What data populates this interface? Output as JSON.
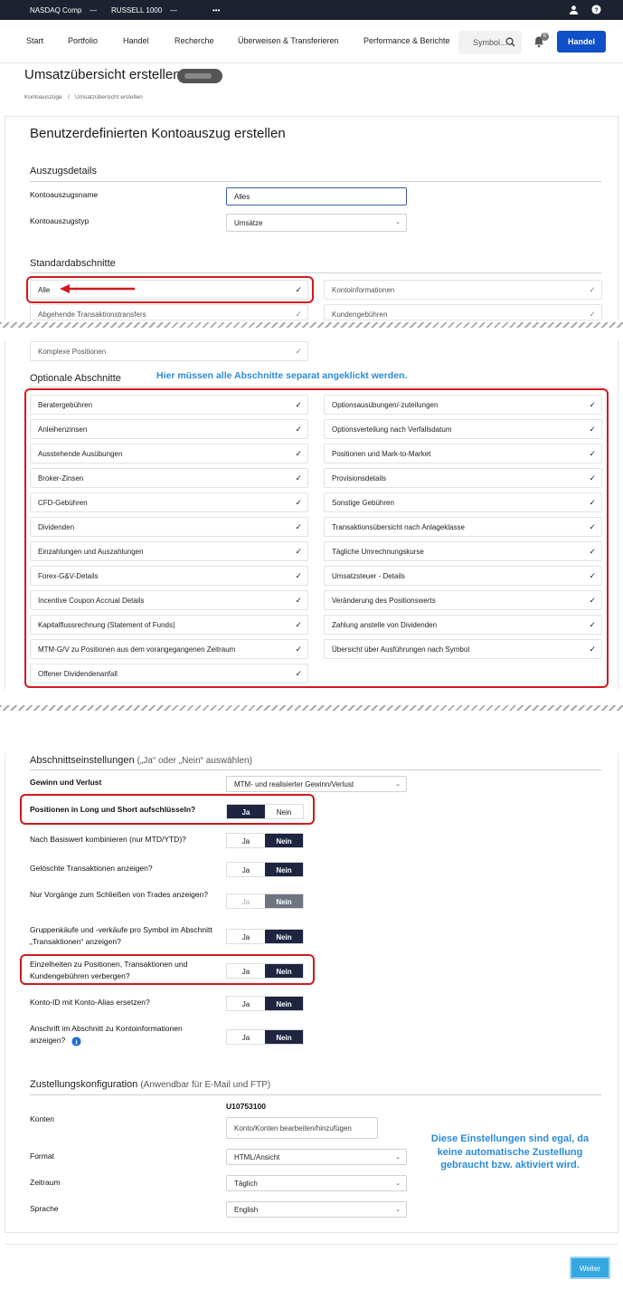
{
  "ticker": {
    "item1": "NASDAQ Comp",
    "dash1": "—",
    "item2": "RUSSELL 1000",
    "dash2": "—",
    "more": "•••"
  },
  "nav": {
    "items": [
      "Start",
      "Portfolio",
      "Handel",
      "Recherche",
      "Überweisen & Transferieren",
      "Performance & Berichte"
    ],
    "search_placeholder": "Symbol...",
    "bell_badge": "6",
    "trade_button": "Handel"
  },
  "page": {
    "title": "Umsatzübersicht erstellen",
    "breadcrumb_1": "Kontoauszüge",
    "breadcrumb_sep": "/",
    "breadcrumb_2": "Umsatzübersicht erstellen"
  },
  "form": {
    "heading": "Benutzerdefinierten Kontoauszug erstellen",
    "details_title": "Auszugsdetails",
    "name_label": "Kontoauszugsname",
    "name_value": "Alles",
    "type_label": "Kontoauszugstyp",
    "type_value": "Umsätze",
    "standard_title": "Standardabschnitte",
    "standard_left": [
      "Alle",
      "Abgehende Transaktionstransfers"
    ],
    "standard_right": [
      "Kontoinformationen",
      "Kundengebühren"
    ],
    "standard_extra": "Komplexe Positionen",
    "optional_title": "Optionale Abschnitte",
    "optional_note": "Hier müssen alle Abschnitte separat angeklickt werden.",
    "optional_left": [
      "Beratergebühren",
      "Anleihenzinsen",
      "Ausstehende Ausübungen",
      "Broker-Zinsen",
      "CFD-Gebühren",
      "Dividenden",
      "Einzahlungen und Auszahlungen",
      "Forex-G&V-Details",
      "Incentive Coupon Accrual Details",
      "Kapitalflussrechnung (Statement of Funds)",
      "MTM-G/V zu Positionen aus dem vorangegangenen Zeitraum",
      "Offener Dividendenanfall"
    ],
    "optional_right": [
      "Optionsausübungen/-zuteilungen",
      "Optionsverteilung nach Verfallsdatum",
      "Positionen und Mark-to-Market",
      "Provisionsdetails",
      "Sonstige Gebühren",
      "Transaktionsübersicht nach Anlageklasse",
      "Tägliche Umrechnungskurse",
      "Umsatzsteuer - Details",
      "Veränderung des Positionswerts",
      "Zahlung anstelle von Dividenden",
      "Übersicht über Ausführungen nach Symbol"
    ],
    "settings_title": "Abschnittseinstellungen",
    "settings_hint": "(„Ja“ oder „Nein“ auswählen)",
    "gv_label": "Gewinn und Verlust",
    "gv_value": "MTM- und realisierter Gewinn/Verlust",
    "toggle_yes": "Ja",
    "toggle_no": "Nein",
    "toggles": [
      {
        "label": "Positionen in Long und Short aufschlüsseln?",
        "value": "Ja"
      },
      {
        "label": "Nach Basiswert kombinieren (nur MTD/YTD)?",
        "value": "Nein"
      },
      {
        "label": "Gelöschte Transaktionen anzeigen?",
        "value": "Nein"
      },
      {
        "label": "Nur Vorgänge zum Schließen von Trades anzeigen?",
        "value": "Nein"
      },
      {
        "label": "Gruppenkäufe und -verkäufe pro Symbol im Abschnitt „Transaktionen“ anzeigen?",
        "value": "Nein"
      },
      {
        "label": "Einzelheiten zu Positionen, Transaktionen und Kundengebühren verbergen?",
        "value": "Nein"
      },
      {
        "label": "Konto-ID mit Konto-Alias ersetzen?",
        "value": "Nein"
      },
      {
        "label": "Anschrift im Abschnitt zu Kontoinformationen anzeigen?",
        "value": "Nein"
      }
    ],
    "delivery_title": "Zustellungskonfiguration",
    "delivery_hint": "(Anwendbar für E-Mail und FTP)",
    "accounts_label": "Konten",
    "account_id": "U10753100",
    "accounts_button": "Konto/Konten bearbeiten/hinzufügen",
    "format_label": "Format",
    "format_value": "HTML/Ansicht",
    "period_label": "Zeitraum",
    "period_value": "Täglich",
    "lang_label": "Sprache",
    "lang_value": "English",
    "delivery_note": "Diese Einstellungen sind egal, da keine automatische Zustellung gebraucht bzw. aktiviert wird.",
    "next_button": "Weiter"
  },
  "colors": {
    "accent": "#0f4fc7",
    "annotation_red": "#d3191f",
    "annotation_blue": "#2a8bd8",
    "toggle_on": "#1d2540"
  }
}
